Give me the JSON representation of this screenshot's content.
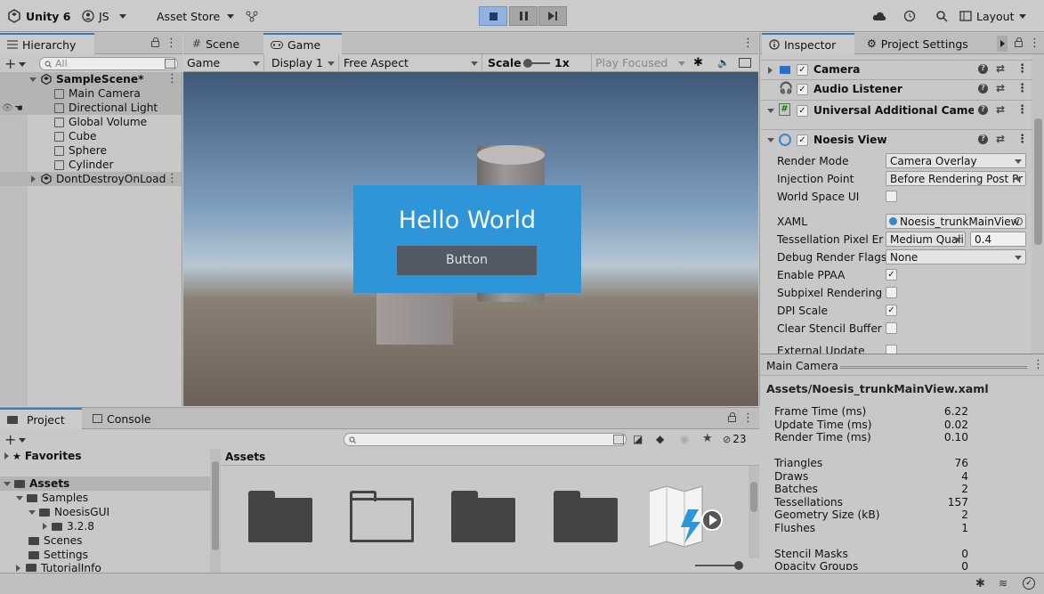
{
  "toolbar": {
    "app_name": "Unity 6",
    "account": "JS",
    "asset_store": "Asset Store",
    "layout": "Layout"
  },
  "hierarchy": {
    "tab": "Hierarchy",
    "search_placeholder": "All",
    "scene": "SampleScene*",
    "items": [
      "Main Camera",
      "Directional Light",
      "Global Volume",
      "Cube",
      "Sphere",
      "Cylinder"
    ],
    "dont_destroy": "DontDestroyOnLoad"
  },
  "view_tabs": {
    "scene": "Scene",
    "game": "Game"
  },
  "game_bar": {
    "mode": "Game",
    "display": "Display 1",
    "aspect": "Free Aspect",
    "scale_label": "Scale",
    "scale_value": "1x",
    "play_focused": "Play Focused"
  },
  "game_view": {
    "hello": "Hello World",
    "button": "Button",
    "accent": "#2d95d8"
  },
  "inspector": {
    "tab": "Inspector",
    "tab2": "Project Settings",
    "components": [
      "Camera",
      "Audio Listener",
      "Universal Additional Camera Da",
      "Noesis View"
    ],
    "props": {
      "render_mode_label": "Render Mode",
      "render_mode": "Camera Overlay",
      "injection_label": "Injection Point",
      "injection": "Before Rendering Post Pr",
      "world_space_label": "World Space UI",
      "xaml_label": "XAML",
      "xaml": "Noesis_trunkMainView",
      "tess_label": "Tessellation Pixel Erro",
      "tess_quality": "Medium Quali",
      "tess_value": "0.4",
      "debug_label": "Debug Render Flags",
      "debug_value": "None",
      "ppaa_label": "Enable PPAA",
      "subpixel_label": "Subpixel Rendering",
      "dpi_label": "DPI Scale",
      "stencil_label": "Clear Stencil Buffer",
      "external_label": "External Update"
    },
    "preview_title": "Main Camera",
    "asset_path": "Assets/Noesis_trunkMainView.xaml",
    "stats": [
      {
        "label": "Frame Time (ms)",
        "value": "6.22"
      },
      {
        "label": "Update Time (ms)",
        "value": "0.02"
      },
      {
        "label": "Render Time (ms)",
        "value": "0.10"
      }
    ],
    "stats2": [
      {
        "label": "Triangles",
        "value": "76"
      },
      {
        "label": "Draws",
        "value": "4"
      },
      {
        "label": "Batches",
        "value": "2"
      },
      {
        "label": "Tessellations",
        "value": "157"
      },
      {
        "label": "Geometry Size (kB)",
        "value": "2"
      },
      {
        "label": "Flushes",
        "value": "1"
      }
    ],
    "stats3": [
      {
        "label": "Stencil Masks",
        "value": "0"
      },
      {
        "label": "Opacity Groups",
        "value": "0"
      }
    ]
  },
  "project": {
    "tab": "Project",
    "console_tab": "Console",
    "badge_count": "23",
    "favorites": "Favorites",
    "assets": "Assets",
    "tree": {
      "samples": "Samples",
      "noesis": "NoesisGUI",
      "version": "3.2.8",
      "scenes": "Scenes",
      "settings": "Settings",
      "tutorial": "TutorialInfo"
    },
    "breadcrumb": "Assets"
  }
}
